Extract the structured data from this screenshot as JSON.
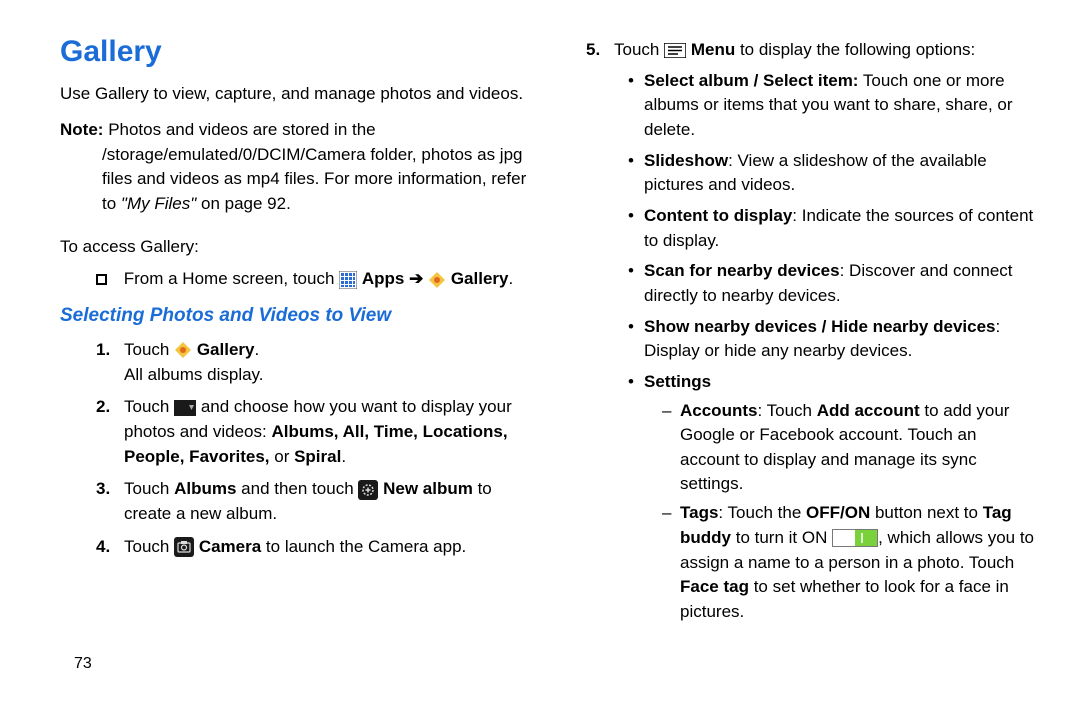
{
  "pageNumber": "73",
  "title": "Gallery",
  "intro": "Use Gallery to view, capture, and manage photos and videos.",
  "note": {
    "label": "Note:",
    "textA": "Photos and videos are stored in the /storage/emulated/0/DCIM/Camera folder, photos as jpg files and videos as mp4 files. For more information, refer to ",
    "ref": "\"My Files\"",
    "textB": " on page 92."
  },
  "accessHeader": "To access Gallery:",
  "fromLine": {
    "pre": "From a Home screen, touch ",
    "apps": "Apps",
    "arrow": " ➔ ",
    "gallery": "Gallery",
    "end": "."
  },
  "subhead": "Selecting Photos and Videos to View",
  "steps": {
    "s1": {
      "num": "1.",
      "a": "Touch ",
      "b": "Gallery",
      "c": ".",
      "line2": "All albums display."
    },
    "s2": {
      "num": "2.",
      "a": "Touch ",
      "b": " and choose how you want to display your photos and videos: ",
      "opts": "Albums, All, Time, Locations, People, Favorites, ",
      "or": "or ",
      "last": "Spiral",
      "end": "."
    },
    "s3": {
      "num": "3.",
      "a": "Touch ",
      "alb": "Albums",
      "b": " and then touch ",
      "na": "New album",
      "c": " to create a new album."
    },
    "s4": {
      "num": "4.",
      "a": "Touch ",
      "cam": "Camera",
      "b": " to launch the Camera app."
    },
    "s5": {
      "num": "5.",
      "a": "Touch ",
      "menu": "Menu",
      "b": " to display the following options:"
    }
  },
  "menuOpts": {
    "o1": {
      "t": "Select album / Select item:",
      "d": " Touch one or more albums or items that you want to share, share, or delete."
    },
    "o2": {
      "t": "Slideshow",
      "d": ": View a slideshow of the available pictures and videos."
    },
    "o3": {
      "t": "Content to display",
      "d": ": Indicate the sources of content to display."
    },
    "o4": {
      "t": "Scan for nearby devices",
      "d": ": Discover and connect directly to nearby devices."
    },
    "o5": {
      "t": "Show nearby devices / Hide nearby devices",
      "d": ": Display or hide any nearby devices."
    },
    "settingsLabel": "Settings",
    "accounts": {
      "t": "Accounts",
      "a": ": Touch ",
      "b": "Add account",
      "c": " to add your Google or Facebook account. Touch an account to display and manage its sync settings."
    },
    "tags": {
      "t": "Tags",
      "a": ": Touch the ",
      "b": "OFF/ON",
      "c": " button next to ",
      "d": "Tag buddy",
      "e": " to turn it ON ",
      "f": ", which allows you to assign a name to a person in a photo. Touch ",
      "g": "Face tag",
      "h": " to set whether to look for a face in pictures."
    }
  }
}
